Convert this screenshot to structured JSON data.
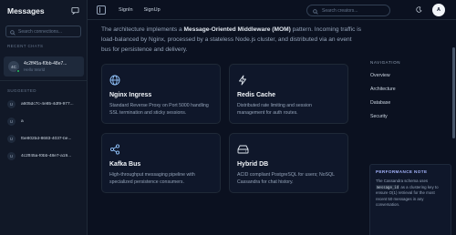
{
  "sidebar": {
    "title": "Messages",
    "search_placeholder": "Search connections...",
    "recent_label": "RECENT CHATS",
    "active_chat": {
      "initials": "4C",
      "name": "4c2ff45a-f0bb-48e7...",
      "preview": "Hello World"
    },
    "suggested_label": "SUGGESTED",
    "suggested": [
      {
        "initial": "U",
        "name": "a605dc7c-4e85-4df9-977..."
      },
      {
        "initial": "U",
        "name": "a"
      },
      {
        "initial": "U",
        "name": "fbe802bd-8683-4037-be..."
      },
      {
        "initial": "U",
        "name": "4c2ff45a-f0bb-48e7-a19..."
      }
    ]
  },
  "topbar": {
    "signin": "SignIn",
    "signup": "SignUp",
    "search_placeholder": "Search creators...",
    "avatar_initial": "A"
  },
  "intro": {
    "part1": "The architecture implements a ",
    "bold": "Message-Oriented Middleware (MOM)",
    "part2": " pattern. Incoming traffic is load-balanced by Nginx, processed by a stateless Node.js cluster, and distributed via an event bus for persistence and delivery."
  },
  "cards": [
    {
      "icon": "globe-icon",
      "title": "Nginx Ingress",
      "desc": "Standard Reverse Proxy on Port 5000 handling SSL termination and sticky sessions."
    },
    {
      "icon": "lightning-icon",
      "title": "Redis Cache",
      "desc": "Distributed rate limiting and session management for auth routes."
    },
    {
      "icon": "share-icon",
      "title": "Kafka Bus",
      "desc": "High-throughput messaging pipeline with specialized persistence consumers."
    },
    {
      "icon": "database-icon",
      "title": "Hybrid DB",
      "desc": "ACID compliant PostgreSQL for users; NoSQL Cassandra for chat history."
    }
  ],
  "navigation": {
    "label": "NAVIGATION",
    "items": [
      "Overview",
      "Architecture",
      "Database",
      "Security"
    ]
  },
  "perf_note": {
    "title": "PERFORMANCE NOTE",
    "text1": "The Cassandra schema uses ",
    "code": "message_id",
    "text2": " as a clustering key to ensure O(1) retrieval for the most recent 50 messages in any conversation."
  },
  "colors": {
    "background": "#0b1120",
    "card": "#0f172a",
    "accent": "#a5b4fc",
    "online": "#22c55e"
  }
}
